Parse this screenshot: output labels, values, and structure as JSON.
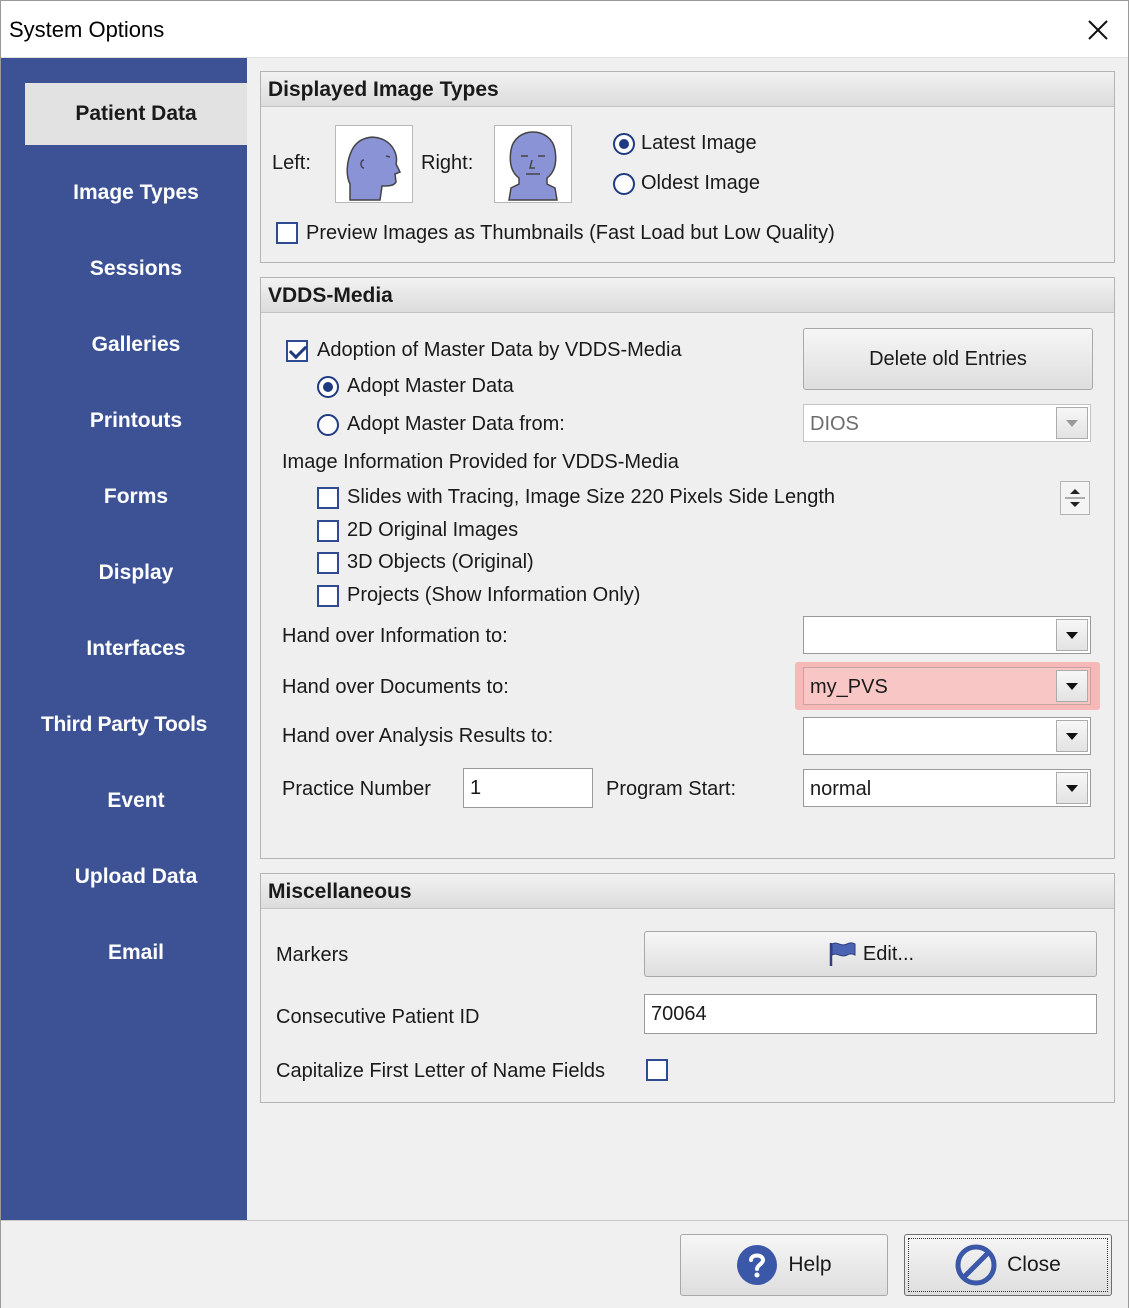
{
  "window": {
    "title": "System Options"
  },
  "sidebar": {
    "items": [
      {
        "label": "Patient Data"
      },
      {
        "label": "Image Types"
      },
      {
        "label": "Sessions"
      },
      {
        "label": "Galleries"
      },
      {
        "label": "Printouts"
      },
      {
        "label": "Forms"
      },
      {
        "label": "Display"
      },
      {
        "label": "Interfaces"
      },
      {
        "label": "Third Party Tools"
      },
      {
        "label": "Event"
      },
      {
        "label": "Upload Data"
      },
      {
        "label": "Email"
      }
    ],
    "active": "Patient Data"
  },
  "displayed_image_types": {
    "title": "Displayed Image Types",
    "left_label": "Left:",
    "right_label": "Right:",
    "latest_image": "Latest Image",
    "oldest_image": "Oldest Image",
    "selected": "Latest Image",
    "preview_thumbnails": "Preview Images as Thumbnails (Fast Load but Low Quality)",
    "preview_checked": false
  },
  "vdds_media": {
    "title": "VDDS-Media",
    "adoption": "Adoption of Master Data by VDDS-Media",
    "adoption_checked": true,
    "adopt_master": "Adopt Master Data",
    "adopt_master_from": "Adopt Master Data from:",
    "adopt_selected": "Adopt Master Data",
    "delete_old": "Delete old Entries",
    "adopt_from_value": "DIOS",
    "image_info_label": "Image Information Provided for VDDS-Media",
    "options": [
      {
        "label": "Slides with Tracing, Image Size 220 Pixels Side Length",
        "checked": false
      },
      {
        "label": "2D Original Images",
        "checked": false
      },
      {
        "label": "3D Objects (Original)",
        "checked": false
      },
      {
        "label": "Projects (Show Information Only)",
        "checked": false
      }
    ],
    "hand_info_label": "Hand over Information to:",
    "hand_info_value": "",
    "hand_docs_label": "Hand over Documents to:",
    "hand_docs_value": "my_PVS",
    "hand_analysis_label": "Hand over Analysis Results to:",
    "hand_analysis_value": "",
    "practice_number_label": "Practice Number",
    "practice_number_value": "1",
    "program_start_label": "Program Start:",
    "program_start_value": "normal",
    "highlight_color": "#f7b8b8"
  },
  "misc": {
    "title": "Miscellaneous",
    "markers_label": "Markers",
    "edit_label": "Edit...",
    "patient_id_label": "Consecutive Patient ID",
    "patient_id_value": "70064",
    "capitalize_label": "Capitalize First Letter of Name Fields",
    "capitalize_checked": false
  },
  "footer": {
    "help_label": "Help",
    "close_label": "Close"
  },
  "colors": {
    "sidebar": "#3c5295",
    "accent": "#1f3a82"
  }
}
